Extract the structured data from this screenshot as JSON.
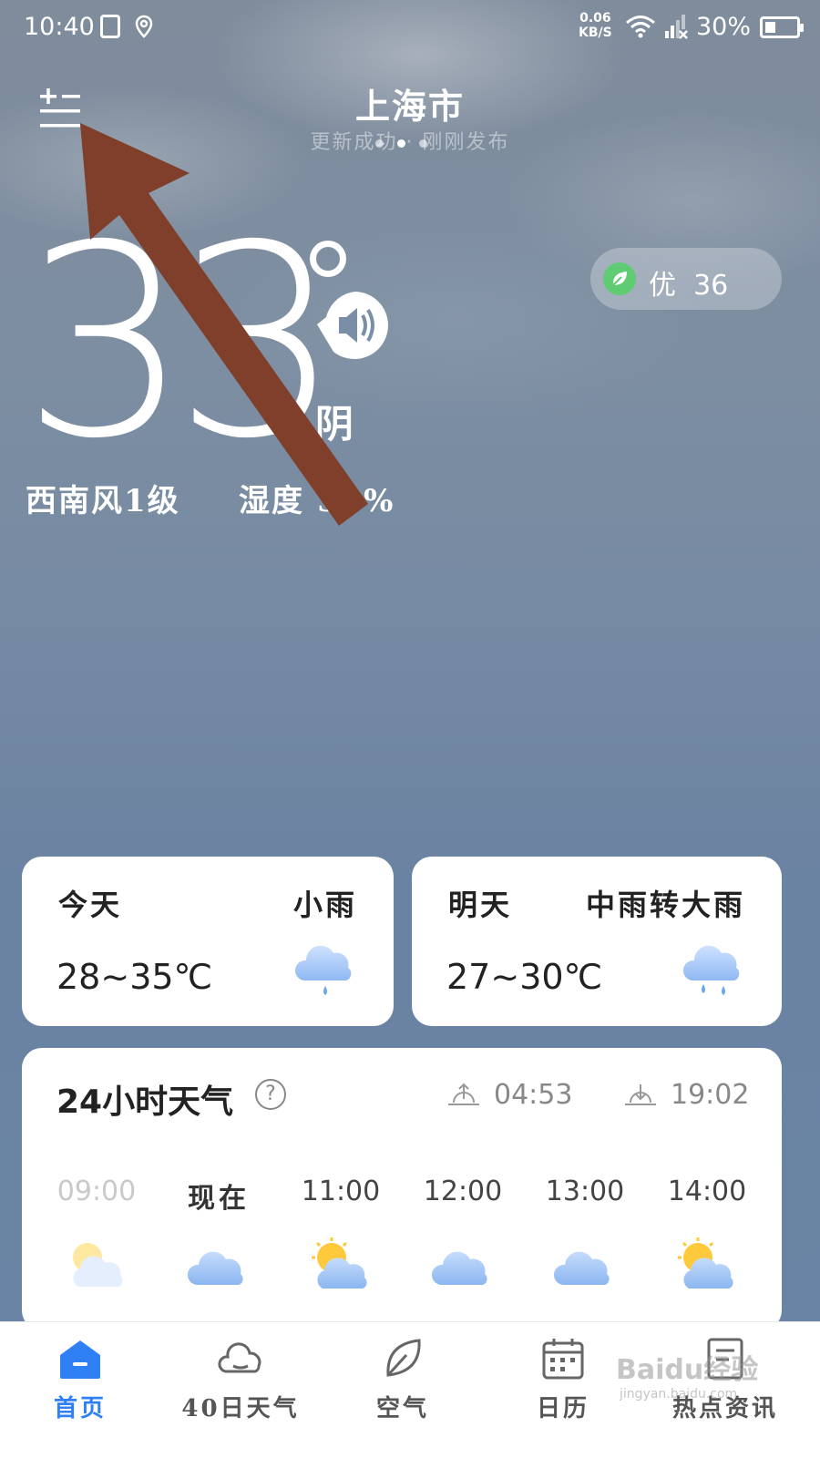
{
  "status_bar": {
    "time": "10:40",
    "speed_value": "0.06",
    "speed_unit": "KB/S",
    "battery_text": "30%",
    "battery_level": 0.3
  },
  "header": {
    "city": "上海市",
    "update_text": "更新成功 · 刚刚发布"
  },
  "current": {
    "temperature": "33",
    "condition": "阴",
    "wind": "西南风1级",
    "humidity": "湿度 59%"
  },
  "aqi": {
    "label": "优",
    "value": "36",
    "color": "#5fcb73"
  },
  "days": [
    {
      "name": "今天",
      "condition": "小雨",
      "range": "28~35℃",
      "icon": "light-rain-icon"
    },
    {
      "name": "明天",
      "condition": "中雨转大雨",
      "range": "27~30℃",
      "icon": "heavy-rain-icon"
    }
  ],
  "hourly": {
    "title": "24小时天气",
    "help": "?",
    "sunrise": "04:53",
    "sunset": "19:02",
    "items": [
      {
        "time": "09:00",
        "icon": "partly-cloudy-icon"
      },
      {
        "time": "现在",
        "icon": "cloudy-icon"
      },
      {
        "time": "11:00",
        "icon": "partly-cloudy-icon"
      },
      {
        "time": "12:00",
        "icon": "cloudy-icon"
      },
      {
        "time": "13:00",
        "icon": "cloudy-icon"
      },
      {
        "time": "14:00",
        "icon": "partly-cloudy-icon"
      }
    ]
  },
  "tabs": [
    {
      "label": "首页",
      "icon": "home-icon"
    },
    {
      "label": "40日天气",
      "icon": "cloud-icon"
    },
    {
      "label": "空气",
      "icon": "leaf-icon"
    },
    {
      "label": "日历",
      "icon": "calendar-icon"
    },
    {
      "label": "热点资讯",
      "icon": "news-icon"
    }
  ],
  "watermark": "Baidu经验",
  "watermark_sub": "jingyan.baidu.com",
  "colors": {
    "accent": "#2f7ff5",
    "sky_top": "#7f8c9c",
    "sky_bottom": "#6a84a6",
    "arrow": "#7f3f2a"
  }
}
